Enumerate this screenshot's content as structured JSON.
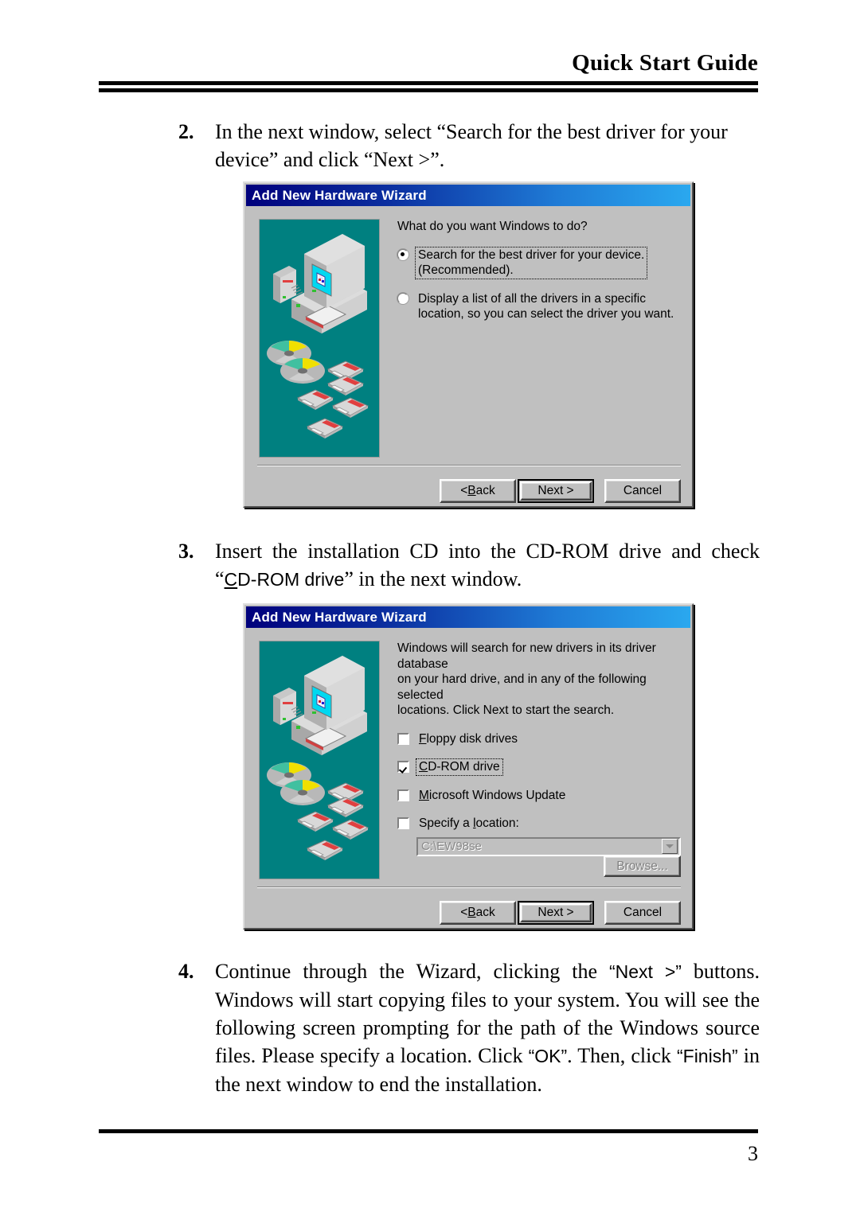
{
  "header": {
    "title": "Quick Start Guide"
  },
  "steps": [
    {
      "number": "2.",
      "text_before": "In the next window, select ",
      "quoted_1": "“Search for the best driver for your",
      "line2_before": "device” and click ",
      "quoted_2": "“Next >”."
    },
    {
      "number": "3.",
      "part_a": "Insert the installation CD into the CD-ROM drive and check “",
      "ui_term": "CD-ROM drive",
      "ui_term_underline": "C",
      "ui_term_rest": "D-ROM drive",
      "part_b": "” in the next window."
    },
    {
      "number": "4.",
      "seg_1": "Continue through the Wizard, clicking the ",
      "seg_2_ui": "“Next >”",
      "seg_3": " buttons. Windows will start copying files to your system. You will see the following screen prompting for the path of the Windows source files. Please specify a location. Click ",
      "seg_4_ui": "“OK”",
      "seg_5": ". Then, click ",
      "seg_6_ui": "“Finish”",
      "seg_7": " in the next window to end the installation."
    }
  ],
  "dialogs": [
    {
      "title": "Add New Hardware Wizard",
      "prompt": "What do you want Windows to do?",
      "options": [
        {
          "type": "radio",
          "checked": true,
          "focused": true,
          "line1": "Search for the best driver for your device.",
          "line2": "(Recommended)."
        },
        {
          "type": "radio",
          "checked": false,
          "focused": false,
          "line1": "Display a list of all the drivers in a specific",
          "line2": "location, so you can select the driver you want."
        }
      ],
      "buttons": {
        "back_prefix": "< ",
        "back_accel": "B",
        "back_rest": "ack",
        "next": "Next >",
        "cancel": "Cancel"
      }
    },
    {
      "title": "Add New Hardware Wizard",
      "prompt_line1": "Windows will search for new drivers in its driver database",
      "prompt_line2": "on your hard drive, and in any of the following selected",
      "prompt_line3": "locations. Click Next to start the search.",
      "checkboxes": [
        {
          "checked": false,
          "focused": false,
          "accel": "F",
          "rest": "loppy disk drives"
        },
        {
          "checked": true,
          "focused": true,
          "accel": "C",
          "rest": "D-ROM drive"
        },
        {
          "checked": false,
          "focused": false,
          "accel": "M",
          "rest": "icrosoft Windows Update"
        },
        {
          "checked": false,
          "focused": false,
          "accel": "",
          "rest": "",
          "label_a": "Specify a ",
          "label_accel": "l",
          "label_b": "ocation:"
        }
      ],
      "combo_value": "C:\\EW98se",
      "browse_label": "Browse...",
      "buttons": {
        "back_prefix": "< ",
        "back_accel": "B",
        "back_rest": "ack",
        "next": "Next >",
        "cancel": "Cancel"
      }
    }
  ],
  "footer": {
    "page_number": "3"
  },
  "colors": {
    "titlebar_start": "#00007c",
    "titlebar_end": "#2aa8ef",
    "dialog_face": "#c0c0c0",
    "illustration_bg": "#008080",
    "screen_cyan": "#00d8f0"
  },
  "icons": {
    "illustration": "computer-cd-floppy-illustration",
    "combo_arrow": "chevron-down-icon"
  }
}
